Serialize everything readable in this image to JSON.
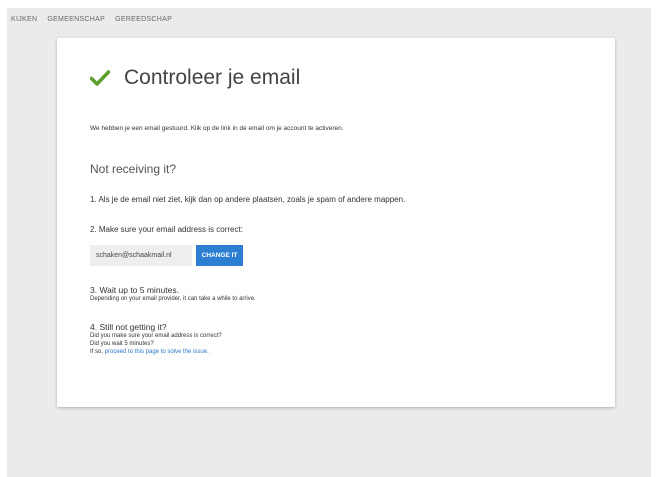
{
  "nav": {
    "items": [
      "KIJKEN",
      "GEMEENSCHAP",
      "GEREEDSCHAP"
    ]
  },
  "card": {
    "title": "Controleer je email",
    "subtitle": "We hebben je een email gestuurd. Klik op de link in de email om je account te activeren.",
    "not_receiving": "Not receiving it?",
    "step1": "1. Als je de email niet ziet, kijk dan op andere plaatsen, zoals je spam of andere mappen.",
    "step2": "2. Make sure your email address is correct:",
    "email_value": "schaken@schaakmail.nl",
    "change_button": "CHANGE IT",
    "step3_title": "3. Wait up to 5 minutes.",
    "step3_text": "Depending on your email provider, it can take a while to arrive.",
    "step4_title": "4. Still not getting it?",
    "step4_line1": "Did you make sure your email address is correct?",
    "step4_line2": "Did you wait 5 minutes?",
    "step4_line3_prefix": "If so, ",
    "step4_link": "proceed to this page to solve the issue."
  },
  "colors": {
    "check": "#5aa02c",
    "button": "#2d7fd3",
    "link": "#2a79c8"
  }
}
